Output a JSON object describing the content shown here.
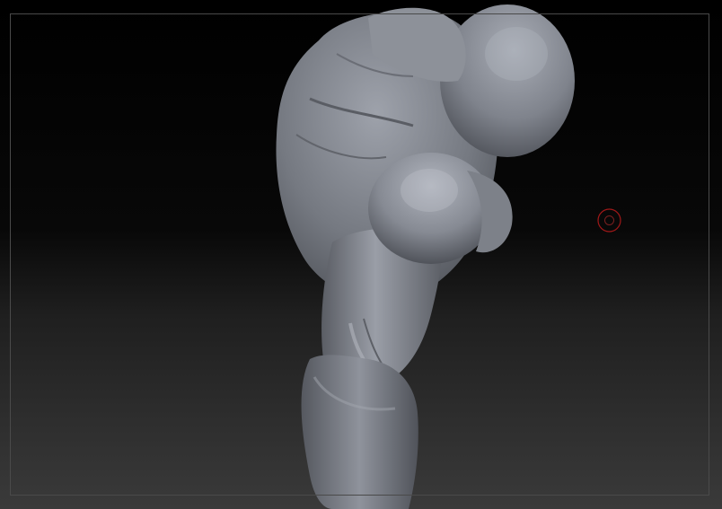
{
  "viewport": {
    "background_top": "#000000",
    "background_bottom": "#3a3a3a",
    "frame_color": "#4a4a4a"
  },
  "model": {
    "icon": "sculpt-mesh-figure",
    "material_color": "#8a8f99"
  },
  "brush_cursor": {
    "icon": "brush-circle-cursor-icon",
    "color": "#a01818"
  }
}
